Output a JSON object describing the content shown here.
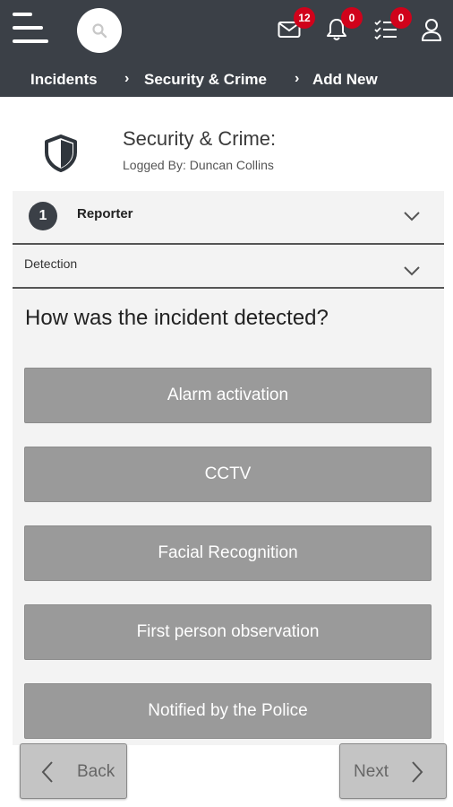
{
  "topbar": {
    "badges": {
      "mail": "12",
      "notifications": "0",
      "tasks": "0"
    }
  },
  "breadcrumb": [
    "Incidents",
    "Security & Crime",
    "Add New"
  ],
  "header": {
    "title": "Security & Crime:",
    "logged_by": "Logged By: Duncan Collins"
  },
  "steps": {
    "reporter": {
      "number": "1",
      "label": "Reporter"
    },
    "detection": {
      "label": "Detection"
    }
  },
  "question": "How was the incident detected?",
  "options": [
    "Alarm activation",
    "CCTV",
    "Facial Recognition",
    "First person observation",
    "Notified by the Police"
  ],
  "nav": {
    "back": "Back",
    "next": "Next"
  },
  "colors": {
    "header_bg": "#3b4047",
    "badge": "#d0021b",
    "option_bg": "#9a9a9a"
  }
}
